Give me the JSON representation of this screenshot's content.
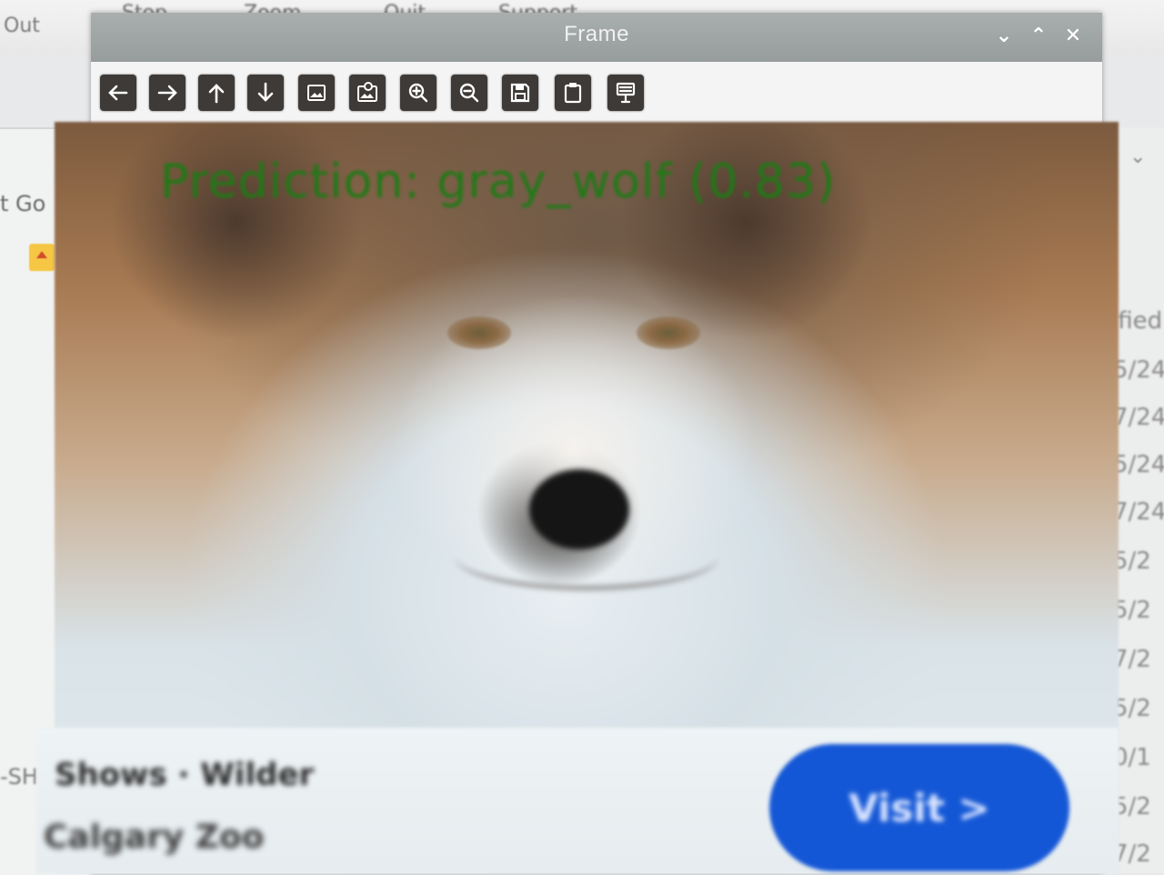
{
  "background": {
    "menu_items": [
      "Stop",
      "Zoom",
      "Quit",
      "Support"
    ],
    "left_labels": {
      "out": "Out",
      "go": "t  Go",
      "sh": "-SH"
    },
    "right_labels": {
      "header": "ified",
      "dates": [
        "5/24",
        "7/24",
        "5/24",
        "7/24",
        "5/2",
        "5/2",
        "7/2",
        "5/2",
        "0/1",
        "5/2",
        "7/2"
      ]
    }
  },
  "window": {
    "title": "Frame",
    "controls": {
      "minimize": "⌄",
      "maximize": "⌃",
      "close": "✕"
    }
  },
  "toolbar": {
    "buttons": [
      {
        "name": "back-button",
        "icon": "arrow-left-icon"
      },
      {
        "name": "forward-button",
        "icon": "arrow-right-icon"
      },
      {
        "name": "up-button",
        "icon": "arrow-up-icon"
      },
      {
        "name": "down-button",
        "icon": "arrow-down-icon"
      },
      {
        "name": "zoom-fit-button",
        "icon": "image-icon"
      },
      {
        "name": "zoom-original-button",
        "icon": "image-zoom-icon"
      },
      {
        "name": "zoom-in-button",
        "icon": "zoom-in-icon"
      },
      {
        "name": "zoom-out-button",
        "icon": "zoom-out-icon"
      },
      {
        "name": "save-button",
        "icon": "save-icon"
      },
      {
        "name": "copy-clipboard-button",
        "icon": "clipboard-icon"
      },
      {
        "name": "properties-button",
        "icon": "properties-icon"
      }
    ]
  },
  "image": {
    "prediction_text": "Prediction: gray_wolf (0.83)",
    "prediction_color": "#1f7a16",
    "banner_line_1": "Shows · Wilder",
    "banner_line_2": "Calgary Zoo",
    "visit_button_label": "Visit >"
  },
  "colors": {
    "titlebar": "#a2a7a7",
    "toolbar_button": "#3e3a37",
    "visit_button": "#1457d6"
  }
}
